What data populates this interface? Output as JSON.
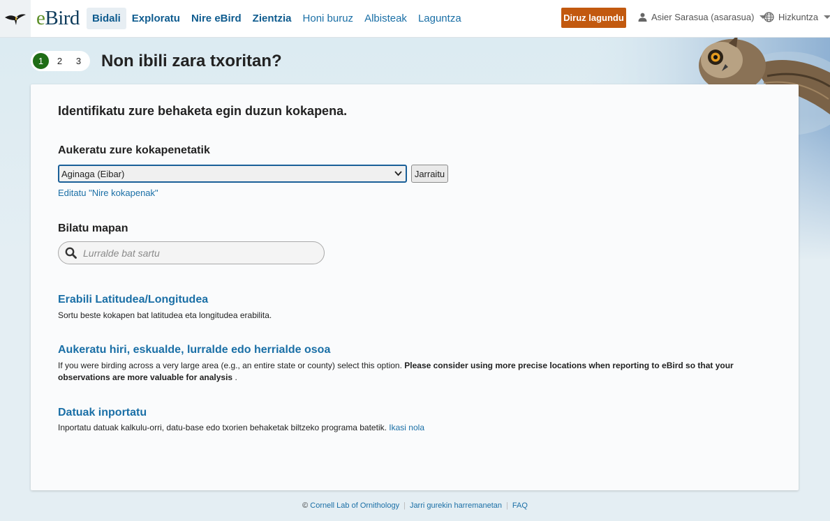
{
  "header": {
    "logo_icon": "ebird-bird-icon",
    "wordmark_e": "e",
    "wordmark_bird": "Bird",
    "nav": [
      {
        "label": "Bidali",
        "name": "nav-bidali"
      },
      {
        "label": "Exploratu",
        "name": "nav-exploratu"
      },
      {
        "label": "Nire eBird",
        "name": "nav-nire-ebird"
      },
      {
        "label": "Zientzia",
        "name": "nav-zientzia"
      },
      {
        "label": "Honi buruz",
        "name": "nav-honi-buruz"
      },
      {
        "label": "Albisteak",
        "name": "nav-albisteak"
      },
      {
        "label": "Laguntza",
        "name": "nav-laguntza"
      }
    ],
    "donate_label": "Diruz lagundu",
    "user_label": "Asier Sarasua (asarasua)",
    "language_label": "Hizkuntza"
  },
  "steps": [
    "1",
    "2",
    "3"
  ],
  "page_title": "Non ibili zara txoritan?",
  "card": {
    "lead": "Identifikatu zure behaketa egin duzun kokapena.",
    "choose_heading": "Aukeratu zure kokapenetatik",
    "selected_location": "Aginaga (Eibar)",
    "continue_label": "Jarraitu",
    "edit_link": "Editatu \"Nire kokapenak\"",
    "map_heading": "Bilatu mapan",
    "search_placeholder": "Lurralde bat sartu",
    "latlong_title": "Erabili Latitudea/Longitudea",
    "latlong_desc": "Sortu beste kokapen bat latitudea eta longitudea erabilita.",
    "region_title": "Aukeratu hiri, eskualde, lurralde edo herrialde osoa",
    "region_desc_plain": "If you were birding across a very large area (e.g., an entire state or county) select this option.",
    "region_desc_bold": "Please consider using more precise locations when reporting to eBird so that your observations are more valuable for analysis",
    "region_desc_end": ".",
    "import_title": "Datuak inportatu",
    "import_desc": "Inportatu datuak kalkulu-orri, datu-base edo txorien behaketak biltzeko programa batetik.",
    "import_link": "Ikasi nola"
  },
  "footer": {
    "copyright": "©",
    "lab": "Cornell Lab of Ornithology",
    "contact": "Jarri gurekin harremanetan",
    "faq": "FAQ"
  },
  "colors": {
    "accent": "#1a6fa6",
    "donate": "#c2590f",
    "step_current": "#1f6d16"
  }
}
